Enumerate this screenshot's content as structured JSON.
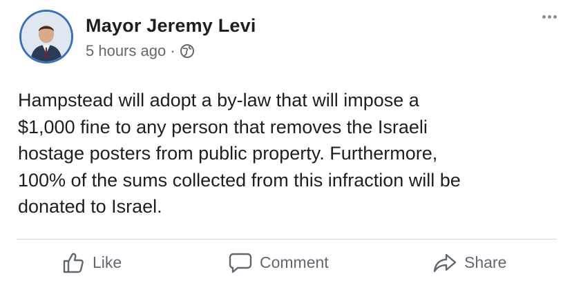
{
  "post": {
    "author": "Mayor Jeremy Levi",
    "timestamp": "5 hours ago",
    "separator": "·",
    "privacy_icon": "globe-icon",
    "menu_icon": "more-options-icon",
    "text": "Hampstead will adopt a by-law that will impose a\n$1,000 fine to any person that removes the Israeli\nhostage posters from public property.  Furthermore,\n100% of the sums collected from this infraction will be\ndonated to Israel."
  },
  "actions": {
    "like_label": "Like",
    "comment_label": "Comment",
    "share_label": "Share"
  },
  "colors": {
    "text": "#1c1e21",
    "secondary": "#65676b",
    "avatar_ring": "#3b6fb5"
  }
}
